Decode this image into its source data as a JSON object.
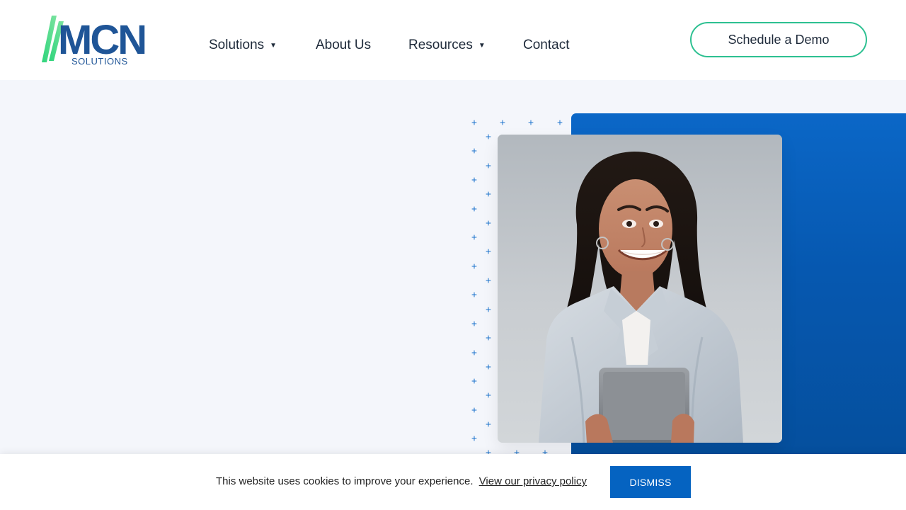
{
  "header": {
    "logo": {
      "main_text": "MCN",
      "sub_text": "SOLUTIONS"
    },
    "nav": [
      {
        "label": "Solutions",
        "has_dropdown": true
      },
      {
        "label": "About Us",
        "has_dropdown": false
      },
      {
        "label": "Resources",
        "has_dropdown": true
      },
      {
        "label": "Contact",
        "has_dropdown": false
      }
    ],
    "cta": {
      "label": "Schedule a Demo"
    }
  },
  "hero": {
    "image": {
      "alt": "Smiling woman holding a tablet"
    },
    "colors": {
      "panel_start": "#0b67c7",
      "panel_end": "#054f9d",
      "pattern": "#1b73cc"
    }
  },
  "cookie_banner": {
    "message": "This website uses cookies to improve your experience.",
    "link_text": "View our privacy policy",
    "button_label": "DISMISS"
  },
  "theme": {
    "brand_blue": "#1f5597",
    "brand_green": "#39d07a",
    "accent_teal": "#2dc091",
    "button_blue": "#0563c1"
  }
}
